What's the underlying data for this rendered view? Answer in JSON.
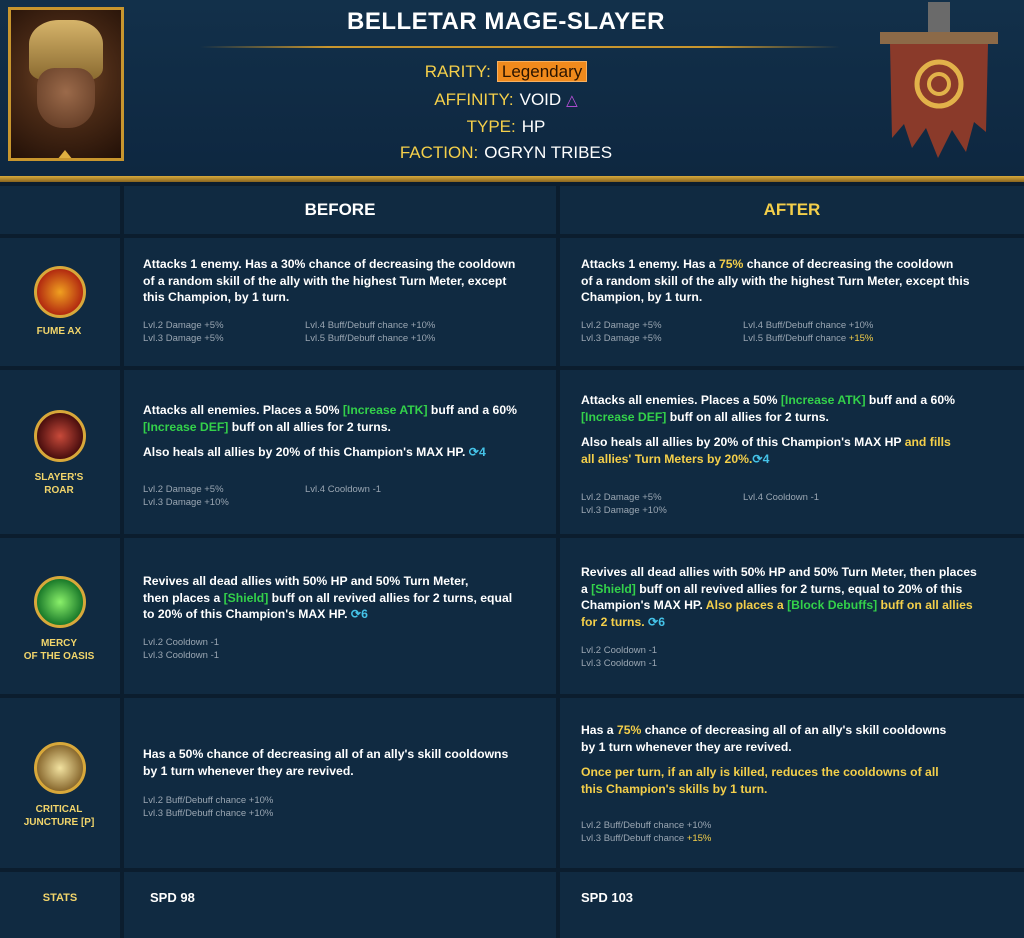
{
  "header": {
    "title": "BELLETAR MAGE-SLAYER",
    "rarity_label": "RARITY:",
    "rarity_value": "Legendary",
    "affinity_label": "AFFINITY:",
    "affinity_value": "VOID",
    "type_label": "TYPE:",
    "type_value": "HP",
    "faction_label": "FACTION:",
    "faction_value": "OGRYN TRIBES"
  },
  "columns": {
    "before": "BEFORE",
    "after": "AFTER"
  },
  "skills": [
    {
      "name_line1": "FUME AX",
      "name_line2": "",
      "icon": "fume-ax-icon",
      "before": {
        "l1": "Attacks 1 enemy. Has a 30% chance of decreasing the cooldown",
        "l2": "of a random skill of the ally with the highest Turn Meter, except",
        "l3": "this Champion, by 1 turn.",
        "m1": "Lvl.2 Damage +5%",
        "m2": "Lvl.3 Damage +5%",
        "m3": "Lvl.4 Buff/Debuff chance +10%",
        "m4": "Lvl.5 Buff/Debuff chance +10%"
      },
      "after": {
        "l1a": "Attacks 1 enemy. Has a ",
        "l1b": "75%",
        "l1c": " chance of decreasing the cooldown",
        "l2": "of a random skill of the ally with the highest Turn Meter, except this",
        "l3": "Champion, by 1 turn.",
        "m1": "Lvl.2 Damage +5%",
        "m2": "Lvl.3 Damage +5%",
        "m3": "Lvl.4 Buff/Debuff chance +10%",
        "m4a": "Lvl.5 Buff/Debuff chance ",
        "m4b": "+15%"
      }
    },
    {
      "name_line1": "SLAYER'S",
      "name_line2": "ROAR",
      "icon": "slayers-roar-icon",
      "before": {
        "l1a": "Attacks all enemies. Places a 50% ",
        "l1b": "[Increase ATK]",
        "l1c": " buff and a 60%",
        "l2a": "[Increase DEF]",
        "l2b": " buff on all allies for 2 turns.",
        "l3": "Also heals all allies by 20% of this Champion's MAX HP.",
        "cd": "4",
        "m1": "Lvl.2 Damage +5%",
        "m2": "Lvl.3 Damage +10%",
        "m3": "Lvl.4 Cooldown -1"
      },
      "after": {
        "l1a": "Attacks all enemies. Places a 50% ",
        "l1b": "[Increase ATK]",
        "l1c": " buff and a 60%",
        "l2a": "[Increase DEF]",
        "l2b": " buff on all allies for 2 turns.",
        "l3a": "Also heals all allies by 20% of this Champion's MAX HP ",
        "l3b": "and fills",
        "l4": "all allies' Turn Meters by 20%.",
        "cd": "4",
        "m1": "Lvl.2 Damage +5%",
        "m2": "Lvl.3 Damage +10%",
        "m3": "Lvl.4 Cooldown -1"
      }
    },
    {
      "name_line1": "MERCY",
      "name_line2": "OF THE OASIS",
      "icon": "mercy-of-the-oasis-icon",
      "before": {
        "l1": "Revives all dead allies with 50% HP and 50% Turn Meter,",
        "l2a": "then places a ",
        "l2b": "[Shield]",
        "l2c": " buff on all revived allies for 2 turns, equal",
        "l3": "to 20% of this Champion's MAX HP.",
        "cd": "6",
        "m1": "Lvl.2 Cooldown -1",
        "m2": "Lvl.3 Cooldown -1"
      },
      "after": {
        "l1": "Revives all dead allies with 50% HP and 50% Turn Meter, then places",
        "l2a": "a ",
        "l2b": "[Shield]",
        "l2c": " buff on all revived allies for 2 turns, equal to 20% of this",
        "l3a": "Champion's MAX HP. ",
        "l3b": "Also places a ",
        "l3c": "[Block Debuffs]",
        "l3d": " buff on all allies",
        "l4": "for 2 turns.",
        "cd": "6",
        "m1": "Lvl.2 Cooldown -1",
        "m2": "Lvl.3 Cooldown -1"
      }
    },
    {
      "name_line1": "CRITICAL",
      "name_line2": "JUNCTURE [P]",
      "icon": "critical-juncture-icon",
      "before": {
        "l1": "Has a 50% chance of decreasing all of an ally's skill cooldowns",
        "l2": "by 1 turn whenever they are revived.",
        "m1": "Lvl.2 Buff/Debuff chance +10%",
        "m2": "Lvl.3 Buff/Debuff chance +10%"
      },
      "after": {
        "l1a": "Has a ",
        "l1b": "75%",
        "l1c": " chance of decreasing all of an ally's skill cooldowns",
        "l2": "by 1 turn whenever they are revived.",
        "l3": "Once per turn, if an ally is killed, reduces the cooldowns of all",
        "l4": "this Champion's skills by 1 turn.",
        "m1": "Lvl.2 Buff/Debuff chance +10%",
        "m2a": "Lvl.3 Buff/Debuff chance ",
        "m2b": "+15%"
      }
    }
  ],
  "stats": {
    "label": "STATS",
    "before": "SPD 98",
    "after": "SPD 103"
  }
}
